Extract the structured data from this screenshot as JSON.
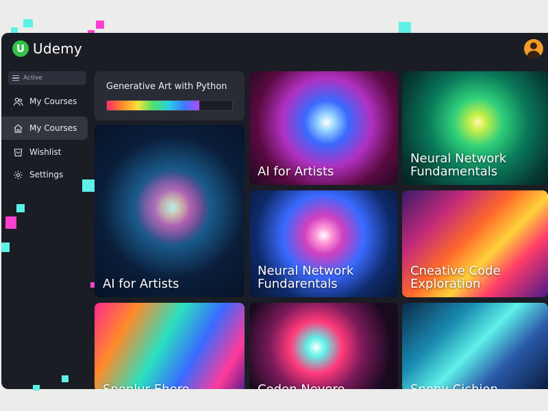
{
  "app": {
    "name": "Udemy",
    "logo_letter": "U",
    "accent": "#35c24a"
  },
  "sidebar": {
    "active_label": "Active",
    "items": [
      {
        "label": "My Courses",
        "icon": "users-icon",
        "selected": false
      },
      {
        "label": "My Courses",
        "icon": "home-icon",
        "selected": true
      },
      {
        "label": "Wishlist",
        "icon": "bag-icon",
        "selected": false
      },
      {
        "label": "Settings",
        "icon": "gear-icon",
        "selected": false
      }
    ]
  },
  "progress": {
    "title": "Generative Art with Python",
    "value": 0.74
  },
  "courses": [
    {
      "title": "AI for Artists"
    },
    {
      "title": "Neural Network Fundamentals"
    },
    {
      "title": "AI for Artists"
    },
    {
      "title": "Neural Network Fundarentals"
    },
    {
      "title": "Cneative Code Exploration"
    },
    {
      "title": "Snonlur Ehero"
    },
    {
      "title": "Coden Nevero"
    },
    {
      "title": "Snony Cichion"
    }
  ]
}
